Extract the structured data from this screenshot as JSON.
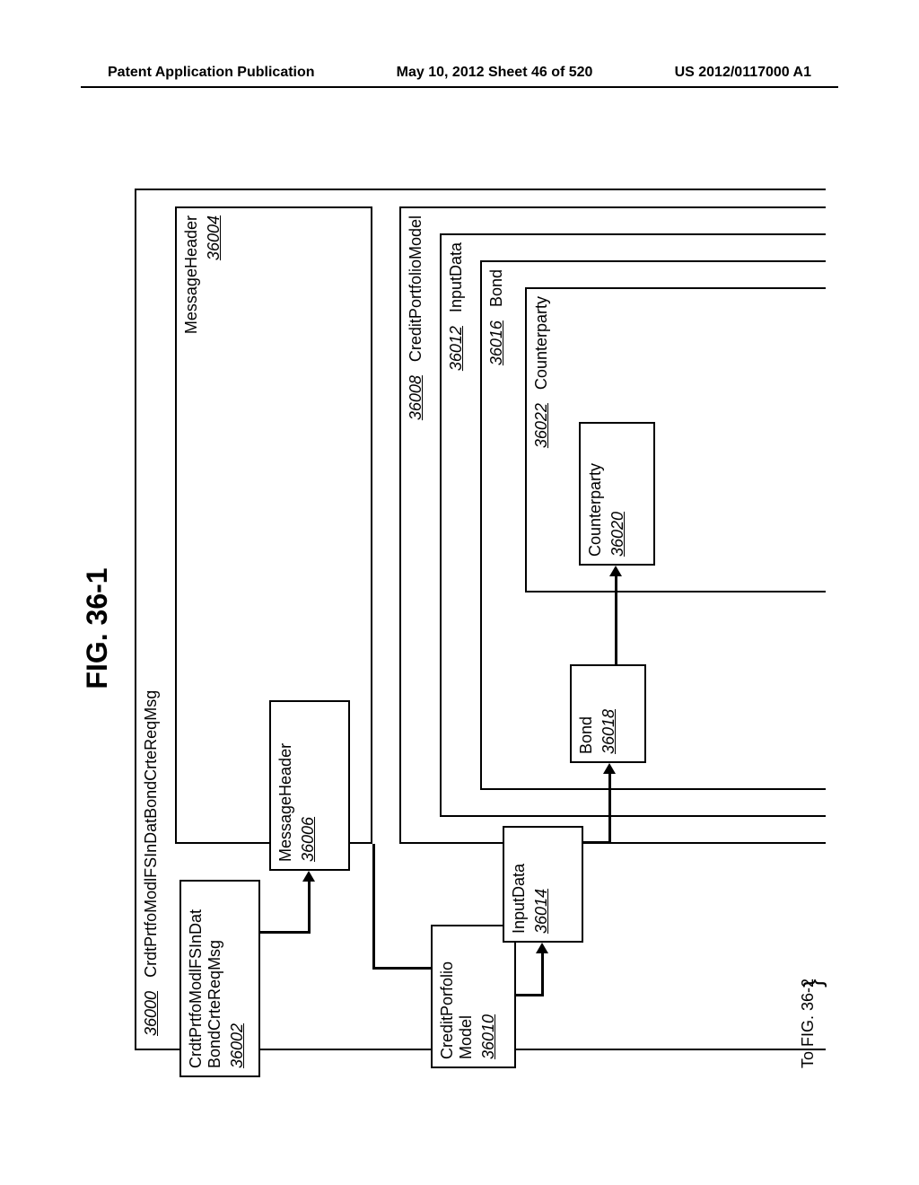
{
  "header": {
    "left": "Patent Application Publication",
    "mid": "May 10, 2012  Sheet 46 of 520",
    "right": "US 2012/0117000 A1"
  },
  "figure_title": "FIG. 36-1",
  "outer": {
    "num": "36000",
    "label": "CrdtPrtfoModlFSInDatBondCrteReqMsg"
  },
  "boxes": {
    "b36002": {
      "line1": "CrdtPrtfoModlFSInDat",
      "line2": "BondCrteReqMsg",
      "num": "36002"
    },
    "b36004": {
      "label": "MessageHeader",
      "num": "36004"
    },
    "b36006": {
      "label": "MessageHeader",
      "num": "36006"
    },
    "b36008": {
      "label": "CreditPortfolioModel",
      "num": "36008"
    },
    "b36010": {
      "line1": "CreditPorfolio",
      "line2": "Model",
      "num": "36010"
    },
    "b36012": {
      "label": "InputData",
      "num": "36012"
    },
    "b36014": {
      "label": "InputData",
      "num": "36014"
    },
    "b36016": {
      "label": "Bond",
      "num": "36016"
    },
    "b36018": {
      "label": "Bond",
      "num": "36018"
    },
    "b36020": {
      "label": "Counterparty",
      "num": "36020"
    },
    "b36022": {
      "label": "Counterparty",
      "num": "36022"
    }
  },
  "continuation": "To FIG. 36-2"
}
